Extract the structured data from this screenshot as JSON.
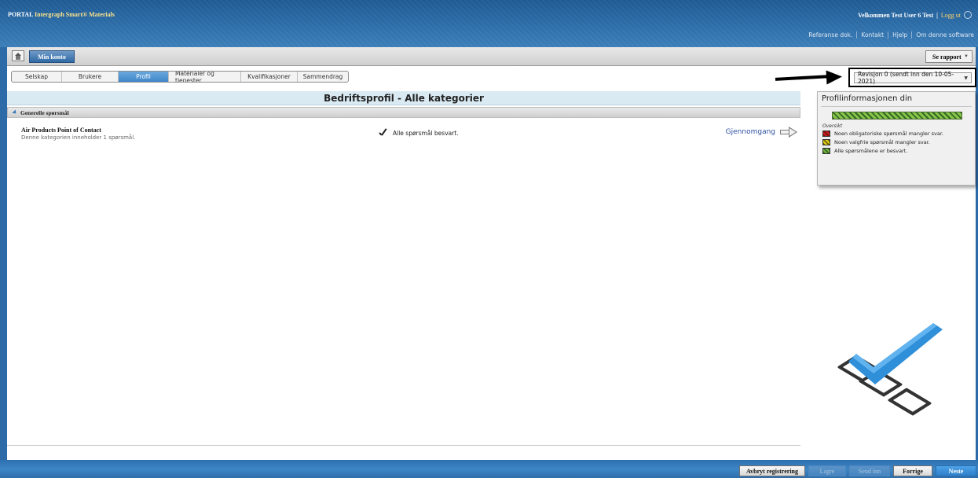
{
  "header": {
    "brand_prefix": "PORTAL",
    "brand_product": "Intergraph Smart® Materials",
    "welcome": "Velkommen Test User 6 Test",
    "separator": "|",
    "logout": "Logg ut",
    "links": [
      "Referanse dok.",
      "Kontakt",
      "Hjelp",
      "Om denne software"
    ]
  },
  "toolbar": {
    "home_icon": "home-icon",
    "tab_label": "Min konto",
    "report_label": "Se rapport"
  },
  "steps": [
    "Selskap",
    "Brukere",
    "Profil",
    "Materialer og tjenester",
    "Kvalifikasjoner",
    "Sammendrag"
  ],
  "active_step": "Profil",
  "revision": {
    "label": "Revisjon 0 (sendt inn den 10-05-2021)"
  },
  "main": {
    "title": "Bedriftsprofil - Alle kategorier",
    "section_label": "Generelle spørsmål",
    "row": {
      "title": "Air Products Point of Contact",
      "subtitle": "Denne kategorien inneholder 1 spørsmål.",
      "status": "Alle spørsmål besvart.",
      "review_link": "Gjennomgang"
    }
  },
  "panel": {
    "title": "Profilinformasjonen din",
    "progress_fraction": 1.0,
    "overview_label": "Oversikt",
    "legend": [
      {
        "text": "Noen obligatoriske spørsmål mangler svar.",
        "color": "#cc2222"
      },
      {
        "text": "Noen valgfrie spørsmål mangler svar.",
        "color": "#e6d21d"
      },
      {
        "text": "Alle spørsmålene er besvart.",
        "color": "#7cb342"
      }
    ]
  },
  "footer": {
    "cancel": "Avbryt registrering",
    "save": "Lagre",
    "submit": "Send inn",
    "previous": "Forrige",
    "next": "Neste"
  },
  "colors": {
    "header_blue": "#2a6aa5",
    "active_step": "#3f86c9",
    "progress_green": "#8bc34a"
  }
}
